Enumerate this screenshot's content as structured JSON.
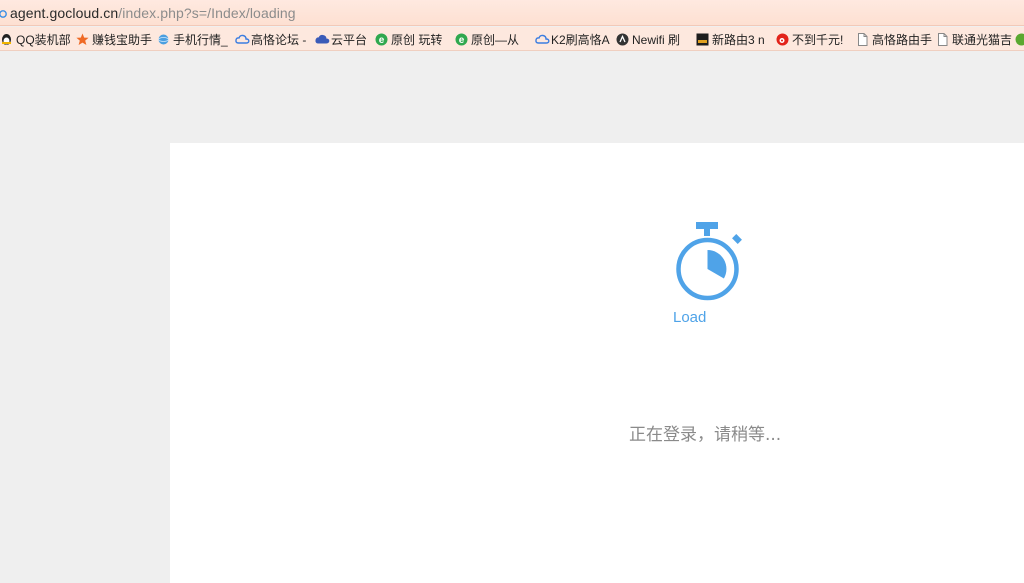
{
  "address_bar": {
    "url_domain": "agent.gocloud.cn",
    "url_path": "/index.php?s=/Index/loading"
  },
  "bookmarks": [
    {
      "label": "QQ装机部",
      "icon": "qq-penguin-icon"
    },
    {
      "label": "赚钱宝助手",
      "icon": "star-icon"
    },
    {
      "label": "手机行情_",
      "icon": "globe-icon"
    },
    {
      "label": "高恪论坛 -",
      "icon": "cloud-icon"
    },
    {
      "label": "云平台",
      "icon": "cloud-icon"
    },
    {
      "label": "原创 玩转",
      "icon": "e-browser-icon"
    },
    {
      "label": "原创—从",
      "icon": "e-browser-icon"
    },
    {
      "label": "K2刷高恪A",
      "icon": "cloud-icon"
    },
    {
      "label": "Newifi 刷",
      "icon": "newifi-icon"
    },
    {
      "label": "新路由3 n",
      "icon": "router-icon"
    },
    {
      "label": "不到千元!",
      "icon": "weibo-icon"
    },
    {
      "label": "高恪路由手",
      "icon": "page-icon"
    },
    {
      "label": "联通光猫吉",
      "icon": "page-icon"
    }
  ],
  "main": {
    "load_label": "Load",
    "status_message": "正在登录，请稍等..."
  },
  "colors": {
    "accent": "#4fa3e8",
    "status_text": "#8a8a8a",
    "page_bg": "#efefef",
    "panel_bg": "#ffffff"
  }
}
